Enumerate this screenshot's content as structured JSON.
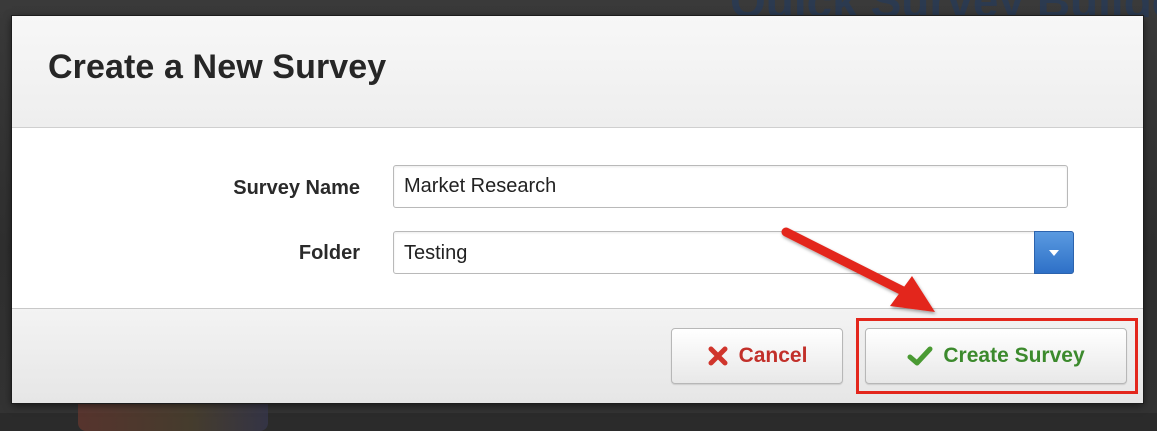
{
  "background": {
    "heading_fragment": "Quick Survey Builder"
  },
  "dialog": {
    "title": "Create a New Survey",
    "fields": {
      "survey_name": {
        "label": "Survey Name",
        "value": "Market Research"
      },
      "folder": {
        "label": "Folder",
        "selected": "Testing"
      }
    },
    "buttons": {
      "cancel": {
        "label": "Cancel",
        "icon": "x-icon"
      },
      "create": {
        "label": "Create Survey",
        "icon": "checkmark-icon"
      }
    }
  },
  "colors": {
    "cancel_text": "#c2302a",
    "create_text": "#3c8a2d",
    "annotation": "#e3261c",
    "select_toggle": "#2e70c7"
  }
}
